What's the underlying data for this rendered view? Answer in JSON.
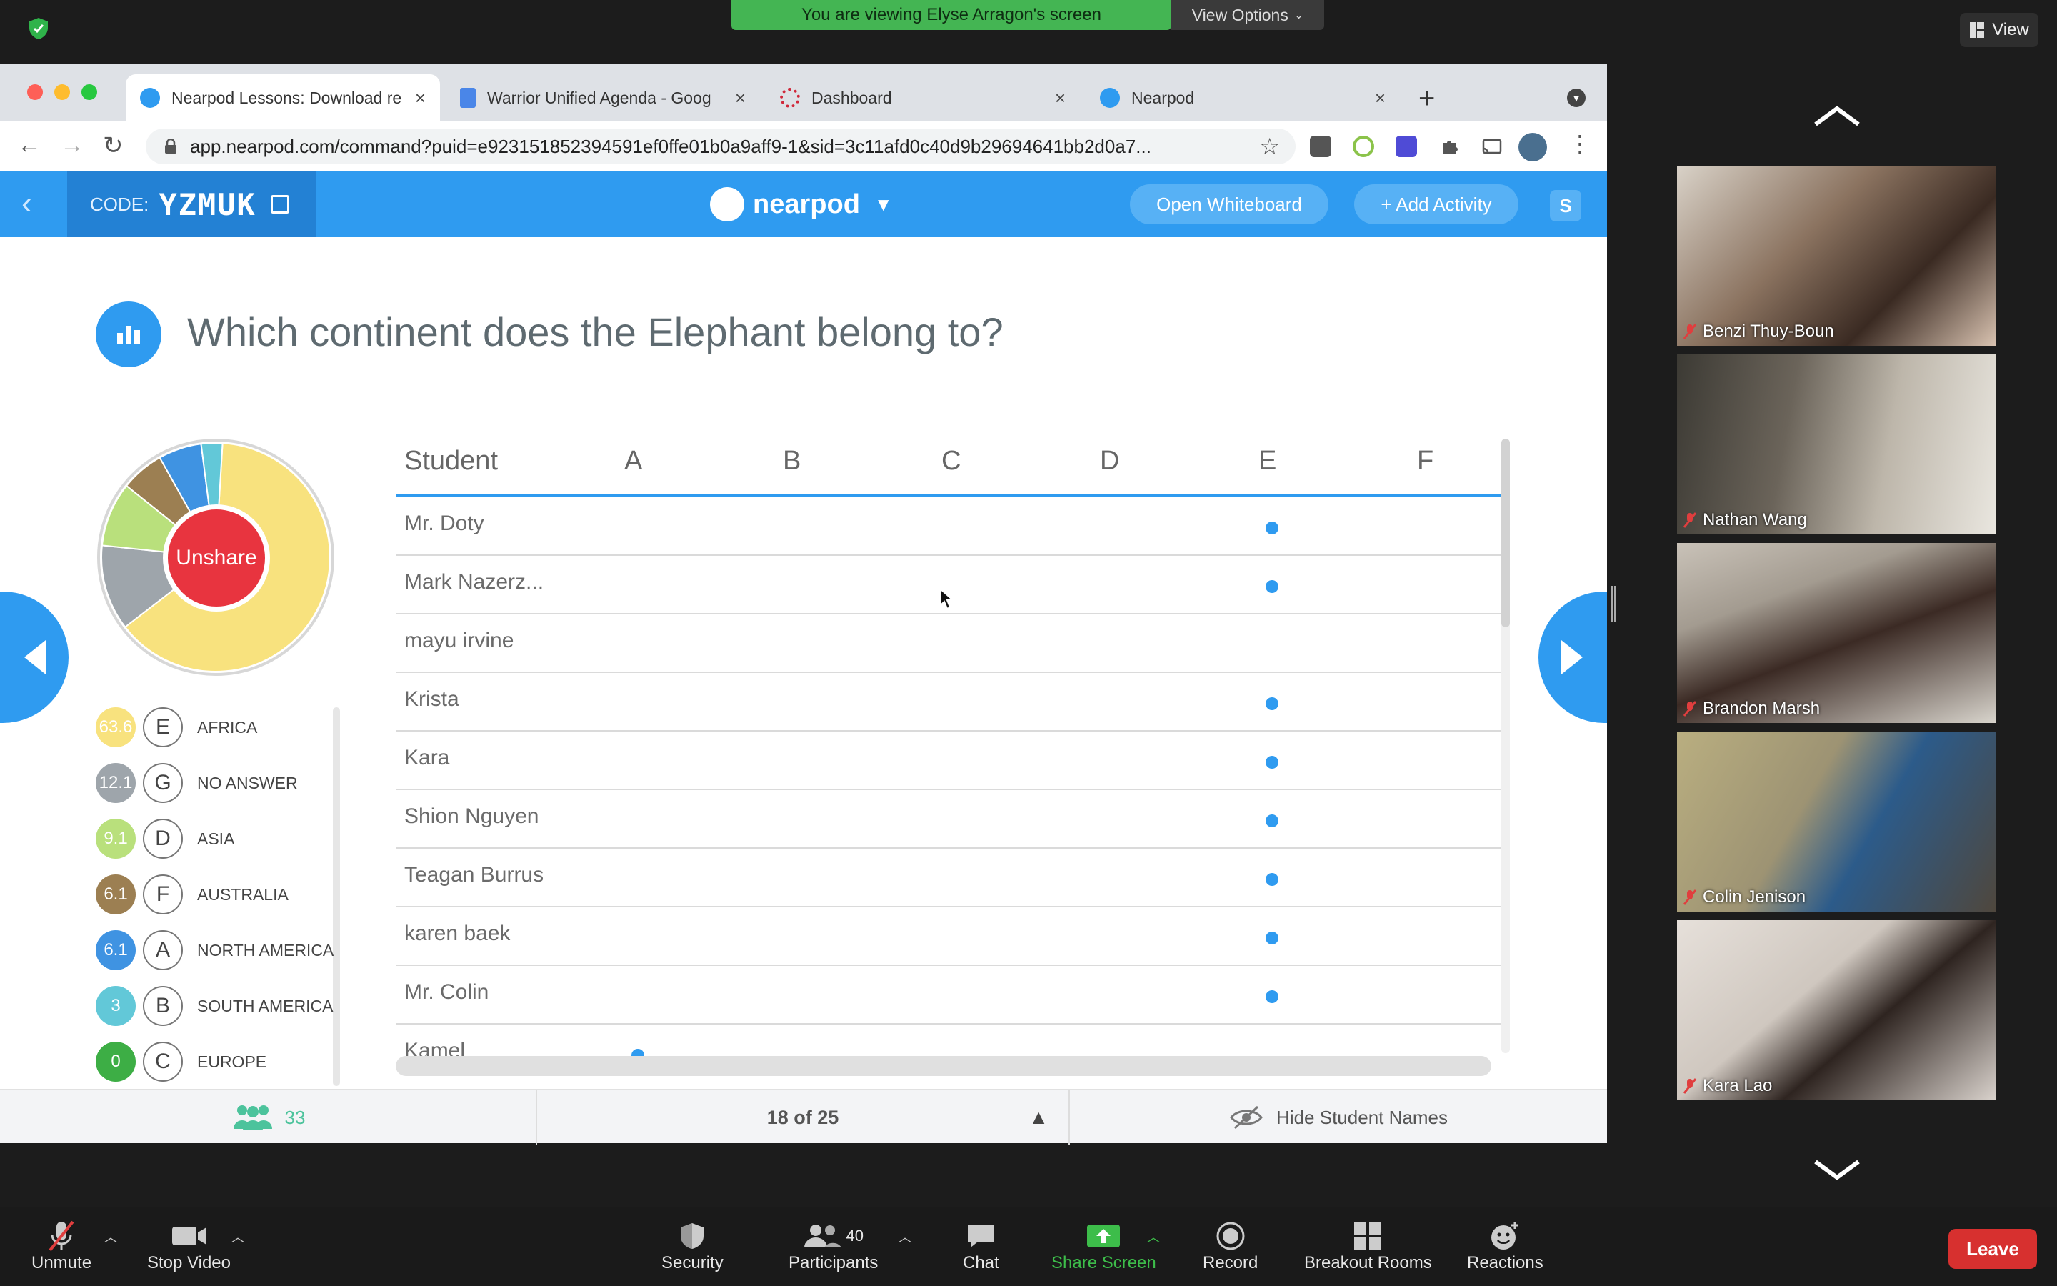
{
  "zoom_top": {
    "banner": "You are viewing Elyse Arragon's screen",
    "view_options": "View Options",
    "view_button": "View"
  },
  "browser": {
    "tabs": [
      {
        "label": "Nearpod Lessons: Download re",
        "close": "×"
      },
      {
        "label": "Warrior Unified Agenda - Goog",
        "close": "×"
      },
      {
        "label": "Dashboard",
        "close": "×"
      },
      {
        "label": "Nearpod",
        "close": "×"
      }
    ],
    "new_tab": "+",
    "url": "app.nearpod.com/command?puid=e923151852394591ef0ffe01b0a9aff9-1&sid=3c11afd0c40d9b29694641bb2d0a7..."
  },
  "nearpod": {
    "code_label": "CODE:",
    "code": "YZMUK",
    "logo": "nearpod",
    "open_whiteboard": "Open Whiteboard",
    "add_activity": "+ Add Activity",
    "badge": "S",
    "question": "Which continent does the Elephant belong to?",
    "unshare": "Unshare",
    "legend": [
      {
        "pct": "63.6",
        "letter": "E",
        "name": "AFRICA",
        "color": "#f8e27e"
      },
      {
        "pct": "12.1",
        "letter": "G",
        "name": "NO ANSWER",
        "color": "#9ea5ab"
      },
      {
        "pct": "9.1",
        "letter": "D",
        "name": "ASIA",
        "color": "#b9e07c"
      },
      {
        "pct": "6.1",
        "letter": "F",
        "name": "AUSTRALIA",
        "color": "#9c7f52"
      },
      {
        "pct": "6.1",
        "letter": "A",
        "name": "NORTH AMERICA",
        "color": "#3f93e2"
      },
      {
        "pct": "3",
        "letter": "B",
        "name": "SOUTH AMERICA",
        "color": "#62c8d8"
      },
      {
        "pct": "0",
        "letter": "C",
        "name": "EUROPE",
        "color": "#3dae45"
      }
    ],
    "table": {
      "headers": [
        "Student",
        "A",
        "B",
        "C",
        "D",
        "E",
        "F"
      ],
      "rows": [
        {
          "name": "Mr. Doty",
          "answer": "E"
        },
        {
          "name": "Mark Nazerz...",
          "answer": "E"
        },
        {
          "name": "mayu irvine",
          "answer": ""
        },
        {
          "name": "Krista",
          "answer": "E"
        },
        {
          "name": "Kara",
          "answer": "E"
        },
        {
          "name": "Shion Nguyen",
          "answer": "E"
        },
        {
          "name": "Teagan Burrus",
          "answer": "E"
        },
        {
          "name": "karen baek",
          "answer": "E"
        },
        {
          "name": "Mr. Colin",
          "answer": "E"
        },
        {
          "name": "Kamel",
          "answer": "A"
        }
      ]
    },
    "footer": {
      "students": "33",
      "pager": "18 of 25",
      "hide_names": "Hide Student Names"
    }
  },
  "gallery": [
    {
      "name": "Benzi Thuy-Boun"
    },
    {
      "name": "Nathan Wang"
    },
    {
      "name": "Brandon Marsh"
    },
    {
      "name": "Colin Jenison"
    },
    {
      "name": "Kara Lao"
    }
  ],
  "zoom_controls": {
    "unmute": "Unmute",
    "stop_video": "Stop Video",
    "security": "Security",
    "participants": "Participants",
    "participants_count": "40",
    "chat": "Chat",
    "share_screen": "Share Screen",
    "record": "Record",
    "breakout_rooms": "Breakout Rooms",
    "reactions": "Reactions",
    "leave": "Leave"
  }
}
